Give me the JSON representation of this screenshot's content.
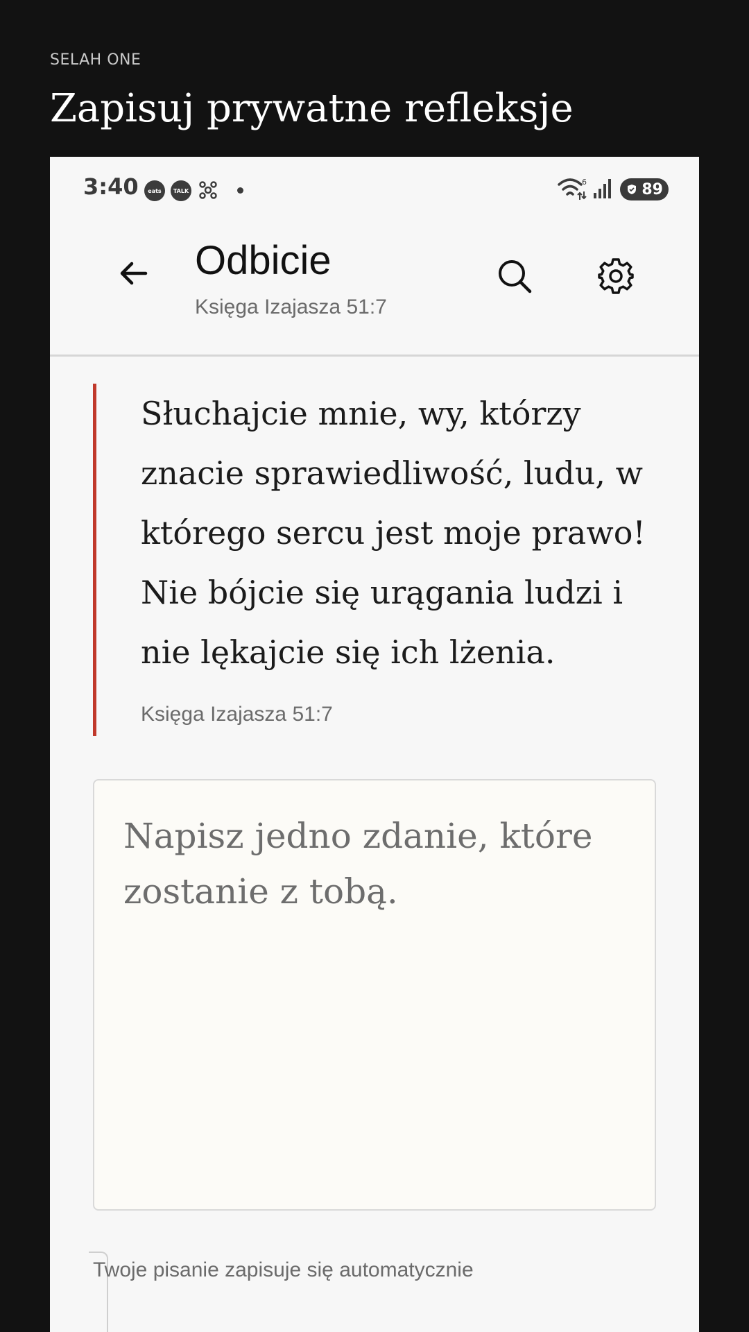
{
  "promo": {
    "brand": "SELAH ONE",
    "headline": "Zapisuj prywatne refleksje"
  },
  "status_bar": {
    "time": "3:40",
    "notification_icons": [
      "coupang-eats-icon",
      "talk-icon",
      "network-icon"
    ],
    "battery": "89",
    "wifi_badge": "6"
  },
  "app_bar": {
    "title": "Odbicie",
    "subtitle": "Księga Izajasza 51:7"
  },
  "verse": {
    "text": "Słuchajcie mnie, wy, którzy znacie sprawiedliwość, ludu, w którego sercu jest moje prawo! Nie bójcie się urągania ludzi i nie lękajcie się ich lżenia.",
    "reference": "Księga Izajasza 51:7"
  },
  "note": {
    "value": "",
    "placeholder": "Napisz jedno zdanie, które zostanie z tobą."
  },
  "footer": {
    "autosave_text": "Twoje pisanie zapisuje się automatycznie"
  },
  "colors": {
    "accent": "#c0392b",
    "background_dark": "#121212",
    "surface": "#f7f7f7",
    "note_surface": "#fcfbf7"
  }
}
